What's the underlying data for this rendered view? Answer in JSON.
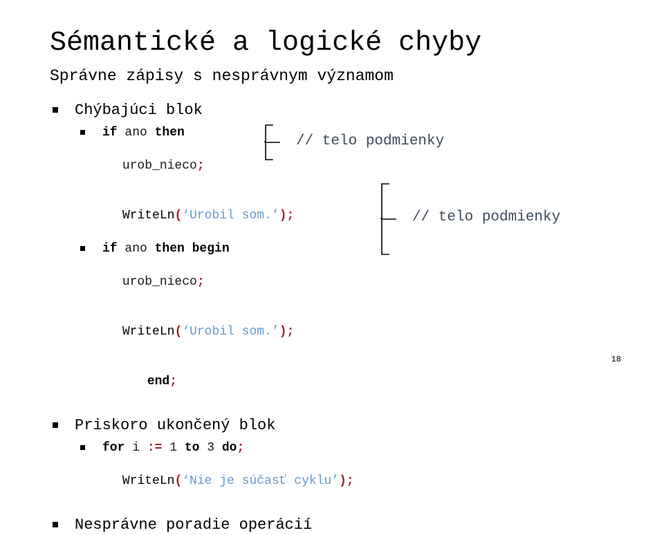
{
  "slide": {
    "title": "Sémantické a logické chyby",
    "subtitle": "Správne zápisy s nesprávnym významom",
    "page_number": "18"
  },
  "colors": {
    "text": "#000000",
    "punctuation": "#A0242C",
    "string": "#6699CC",
    "comment": "#3B4A5A",
    "background": "#FFFFFF"
  },
  "sections": {
    "missing_block": {
      "heading": "Chýbajúci blok",
      "example_a": {
        "line1": {
          "kw1": "if",
          "id1": " ano ",
          "kw2": "then"
        },
        "line2": {
          "id": "urob_nieco",
          "pun": ";"
        },
        "line3": {
          "fn": "WriteLn",
          "open": "(",
          "str": "‘Urobil som.’",
          "close": ")",
          "semi": ";"
        },
        "comment": "// telo podmienky"
      },
      "example_b": {
        "line1": {
          "kw1": "if",
          "id1": " ano ",
          "kw2": "then begin"
        },
        "line2": {
          "id": "urob_nieco",
          "pun": ";"
        },
        "line3": {
          "fn": "WriteLn",
          "open": "(",
          "str": "‘Urobil som.’",
          "close": ")",
          "semi": ";"
        },
        "line4": {
          "kw": "end",
          "pun": ";"
        },
        "comment": "// telo podmienky"
      }
    },
    "early_end_block": {
      "heading": "Priskoro ukončený blok",
      "example": {
        "line1": {
          "kw1": "for",
          "id1": " i ",
          "assign": ":=",
          "num1": " 1 ",
          "kw2": "to",
          "num2": " 3 ",
          "kw3": "do",
          "pun": ";"
        },
        "line2": {
          "fn": "WriteLn",
          "open": "(",
          "str": "‘Nie je súčasť cyklu’",
          "close": ")",
          "semi": ";"
        }
      }
    },
    "wrong_order": {
      "heading": "Nesprávne poradie operácií"
    }
  }
}
